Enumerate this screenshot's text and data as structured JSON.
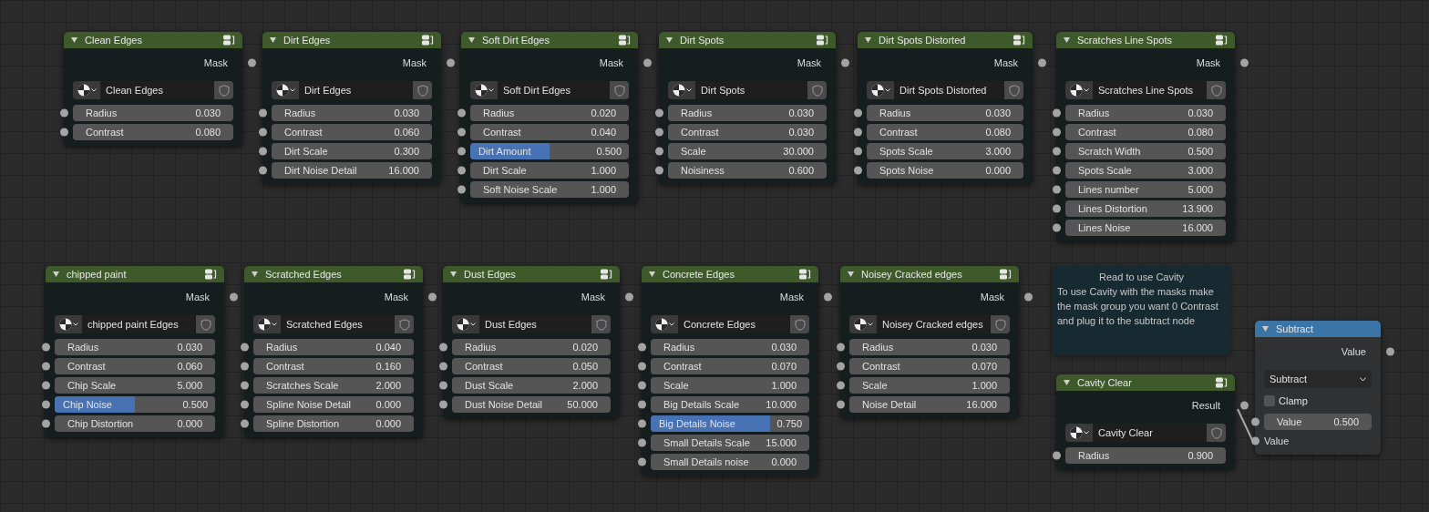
{
  "nodes": [
    {
      "kind": "group",
      "title": "Clean Edges",
      "output": "Mask",
      "datablock": "Clean Edges",
      "inputs": [
        {
          "kind": "number",
          "label": "Radius",
          "value": "0.030"
        },
        {
          "kind": "number",
          "label": "Contrast",
          "value": "0.080"
        }
      ]
    },
    {
      "kind": "group",
      "title": "Dirt Edges",
      "output": "Mask",
      "datablock": "Dirt Edges",
      "inputs": [
        {
          "kind": "number",
          "label": "Radius",
          "value": "0.030"
        },
        {
          "kind": "number",
          "label": "Contrast",
          "value": "0.060"
        },
        {
          "kind": "number",
          "label": "Dirt Scale",
          "value": "0.300"
        },
        {
          "kind": "number",
          "label": "Dirt Noise Detail",
          "value": "16.000"
        }
      ]
    },
    {
      "kind": "group",
      "title": "Soft Dirt Edges",
      "output": "Mask",
      "datablock": "Soft Dirt Edges",
      "inputs": [
        {
          "kind": "number",
          "label": "Radius",
          "value": "0.020"
        },
        {
          "kind": "number",
          "label": "Contrast",
          "value": "0.040"
        },
        {
          "kind": "factor",
          "label": "Dirt Amount",
          "value": "0.500",
          "level": 0.5
        },
        {
          "kind": "number",
          "label": "Dirt Scale",
          "value": "1.000"
        },
        {
          "kind": "number",
          "label": "Soft Noise Scale",
          "value": "1.000"
        }
      ]
    },
    {
      "kind": "group",
      "title": "Dirt Spots",
      "output": "Mask",
      "datablock": "Dirt Spots",
      "inputs": [
        {
          "kind": "number",
          "label": "Radius",
          "value": "0.030"
        },
        {
          "kind": "number",
          "label": "Contrast",
          "value": "0.030"
        },
        {
          "kind": "number",
          "label": "Scale",
          "value": "30.000"
        },
        {
          "kind": "number",
          "label": "Noisiness",
          "value": "0.600"
        }
      ]
    },
    {
      "kind": "group",
      "title": "Dirt Spots Distorted",
      "output": "Mask",
      "datablock": "Dirt Spots Distorted",
      "inputs": [
        {
          "kind": "number",
          "label": "Radius",
          "value": "0.030"
        },
        {
          "kind": "number",
          "label": "Contrast",
          "value": "0.080"
        },
        {
          "kind": "number",
          "label": "Spots Scale",
          "value": "3.000"
        },
        {
          "kind": "number",
          "label": "Spots Noise",
          "value": "0.000"
        }
      ]
    },
    {
      "kind": "group",
      "title": "Scratches Line Spots",
      "output": "Mask",
      "datablock": "Scratches Line Spots",
      "inputs": [
        {
          "kind": "number",
          "label": "Radius",
          "value": "0.030"
        },
        {
          "kind": "number",
          "label": "Contrast",
          "value": "0.080"
        },
        {
          "kind": "number",
          "label": "Scratch Width",
          "value": "0.500"
        },
        {
          "kind": "number",
          "label": "Spots Scale",
          "value": "3.000"
        },
        {
          "kind": "number",
          "label": "Lines number",
          "value": "5.000"
        },
        {
          "kind": "number",
          "label": "Lines Distortion",
          "value": "13.900"
        },
        {
          "kind": "number",
          "label": "Lines Noise",
          "value": "16.000"
        }
      ]
    },
    {
      "kind": "group",
      "title": "chipped paint",
      "output": "Mask",
      "datablock": "chipped paint Edges",
      "inputs": [
        {
          "kind": "number",
          "label": "Radius",
          "value": "0.030"
        },
        {
          "kind": "number",
          "label": "Contrast",
          "value": "0.060"
        },
        {
          "kind": "number",
          "label": "Chip Scale",
          "value": "5.000"
        },
        {
          "kind": "factor",
          "label": "Chip Noise",
          "value": "0.500",
          "level": 0.5
        },
        {
          "kind": "number",
          "label": "Chip Distortion",
          "value": "0.000"
        }
      ]
    },
    {
      "kind": "group",
      "title": "Scratched Edges",
      "output": "Mask",
      "datablock": "Scratched Edges",
      "inputs": [
        {
          "kind": "number",
          "label": "Radius",
          "value": "0.040"
        },
        {
          "kind": "number",
          "label": "Contrast",
          "value": "0.160"
        },
        {
          "kind": "number",
          "label": "Scratches Scale",
          "value": "2.000"
        },
        {
          "kind": "number",
          "label": "Spline Noise Detail",
          "value": "0.000"
        },
        {
          "kind": "number",
          "label": "Spline Distortion",
          "value": "0.000"
        }
      ]
    },
    {
      "kind": "group",
      "title": "Dust Edges",
      "output": "Mask",
      "datablock": "Dust Edges",
      "inputs": [
        {
          "kind": "number",
          "label": "Radius",
          "value": "0.020"
        },
        {
          "kind": "number",
          "label": "Contrast",
          "value": "0.050"
        },
        {
          "kind": "number",
          "label": "Dust Scale",
          "value": "2.000"
        },
        {
          "kind": "number",
          "label": "Dust Noise Detail",
          "value": "50.000"
        }
      ]
    },
    {
      "kind": "group",
      "title": "Concrete Edges",
      "output": "Mask",
      "datablock": "Concrete Edges",
      "inputs": [
        {
          "kind": "number",
          "label": "Radius",
          "value": "0.030"
        },
        {
          "kind": "number",
          "label": "Contrast",
          "value": "0.070"
        },
        {
          "kind": "number",
          "label": "Scale",
          "value": "1.000"
        },
        {
          "kind": "number",
          "label": "Big Details Scale",
          "value": "10.000"
        },
        {
          "kind": "factor",
          "label": "Big Details Noise",
          "value": "0.750",
          "level": 0.75
        },
        {
          "kind": "number",
          "label": "Small Details Scale",
          "value": "15.000"
        },
        {
          "kind": "number",
          "label": "Small Details noise",
          "value": "0.000"
        }
      ]
    },
    {
      "kind": "group",
      "title": "Noisey Cracked edges",
      "output": "Mask",
      "datablock": "Noisey Cracked edges",
      "inputs": [
        {
          "kind": "number",
          "label": "Radius",
          "value": "0.030"
        },
        {
          "kind": "number",
          "label": "Contrast",
          "value": "0.070"
        },
        {
          "kind": "number",
          "label": "Scale",
          "value": "1.000"
        },
        {
          "kind": "number",
          "label": "Noise Detail",
          "value": "16.000"
        }
      ]
    },
    {
      "kind": "group",
      "title": "Cavity Clear",
      "output": "Result",
      "datablock": "Cavity Clear",
      "inputs": [
        {
          "kind": "number",
          "label": "Radius",
          "value": "0.900"
        }
      ]
    },
    {
      "kind": "math",
      "title": "Subtract",
      "output": "Value",
      "operation": "Subtract",
      "clamp": {
        "label": "Clamp",
        "checked": false
      },
      "inputs": [
        {
          "kind": "number",
          "label": "Value",
          "value": "0.500"
        },
        {
          "kind": "socket",
          "label": "Value"
        }
      ]
    }
  ],
  "frame": {
    "title": "Read to use Cavity",
    "text": "To use Cavity with the masks make the mask group you want 0 Contrast and plug it to the subtract node"
  }
}
